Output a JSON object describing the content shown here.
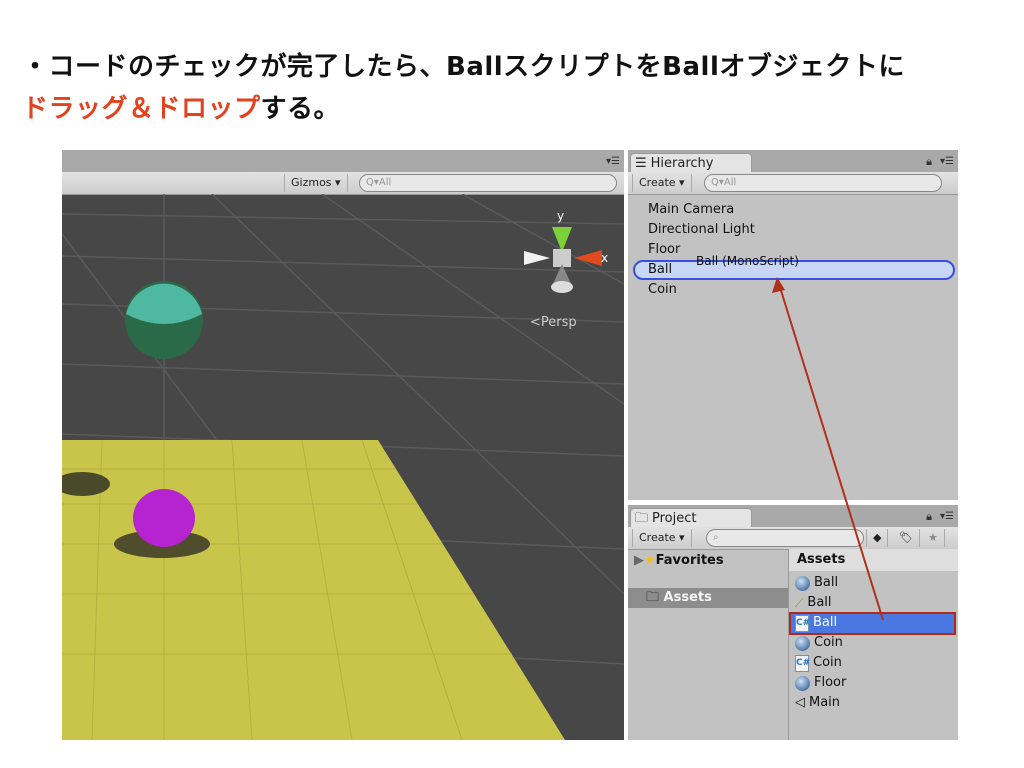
{
  "slide": {
    "line1": "・コードのチェックが完了したら、BallスクリプトをBallオブジェクトに",
    "line2_highlight": "ドラッグ＆ドロップ",
    "line2_rest": "する。",
    "highlight_color": "#e4411f"
  },
  "scene": {
    "gizmos_label": "Gizmos",
    "search_placeholder": "All",
    "axis_y": "y",
    "axis_x": "x",
    "persp_label": "Persp"
  },
  "hierarchy": {
    "tab_label": "Hierarchy",
    "create_label": "Create",
    "search_placeholder": "All",
    "items": [
      "Main Camera",
      "Directional Light",
      "Floor",
      "Ball",
      "Coin"
    ],
    "drag_label": "Ball (MonoScript)"
  },
  "project": {
    "tab_label": "Project",
    "create_label": "Create",
    "favorites_label": "Favorites",
    "assets_folder": "Assets",
    "assets_header": "Assets",
    "assets": [
      {
        "name": "Ball",
        "icon": "material-sphere-icon"
      },
      {
        "name": "Ball",
        "icon": "physic-material-icon"
      },
      {
        "name": "Ball",
        "icon": "csharp-script-icon",
        "selected": true
      },
      {
        "name": "Coin",
        "icon": "material-sphere-icon"
      },
      {
        "name": "Coin",
        "icon": "csharp-script-icon"
      },
      {
        "name": "Floor",
        "icon": "material-sphere-icon"
      },
      {
        "name": "Main",
        "icon": "unity-scene-icon"
      }
    ]
  }
}
